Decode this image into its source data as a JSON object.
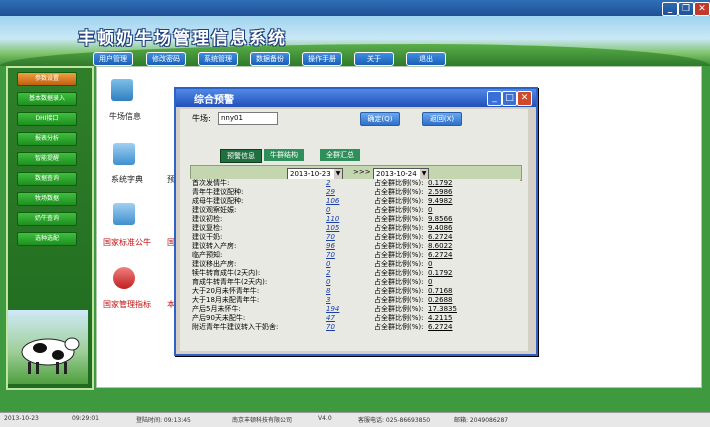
{
  "app": {
    "title": "丰顿奶牛场管理信息系统",
    "nav": [
      "用户管理",
      "修改密码",
      "系统管理",
      "数据备份",
      "操作手册",
      "关于",
      "退出"
    ]
  },
  "sidebar": {
    "items": [
      "参数设置",
      "基本数据录入",
      "DHI接口",
      "报表分析",
      "智能提醒",
      "数据查询",
      "牧场数据",
      "奶牛查询",
      "选种选配"
    ]
  },
  "main": {
    "labels": [
      "牛场信息",
      "系统字典",
      "国家标准公牛",
      "国家管理指标"
    ],
    "partial_labels": [
      "预",
      "国",
      "本"
    ]
  },
  "dialog": {
    "title": "综合预警",
    "cow_label": "牛场:",
    "cow_value": "nny01",
    "confirm_btn": "确定(Q)",
    "back_btn": "返回(X)",
    "tabs": [
      "预警信息",
      "牛群结构",
      "全群汇总"
    ],
    "date_from": "2013-10-23",
    "date_sep": ">>>",
    "date_to": "2013-10-24",
    "rows": [
      {
        "label": "首次发情牛:",
        "count": "2",
        "pct_label": "占全群比例(%):",
        "pct": "0.1792"
      },
      {
        "label": "青年牛建议配种:",
        "count": "29",
        "pct_label": "占全群比例(%):",
        "pct": "2.5986"
      },
      {
        "label": "成母牛建议配种:",
        "count": "106",
        "pct_label": "占全群比例(%):",
        "pct": "9.4982"
      },
      {
        "label": "建议观察妊娠:",
        "count": "0",
        "pct_label": "占全群比例(%):",
        "pct": "0"
      },
      {
        "label": "建议初检:",
        "count": "110",
        "pct_label": "占全群比例(%):",
        "pct": "9.8566"
      },
      {
        "label": "建议复检:",
        "count": "105",
        "pct_label": "占全群比例(%):",
        "pct": "9.4086"
      },
      {
        "label": "建议干奶:",
        "count": "70",
        "pct_label": "占全群比例(%):",
        "pct": "6.2724"
      },
      {
        "label": "建议转入产房:",
        "count": "96",
        "pct_label": "占全群比例(%):",
        "pct": "8.6022"
      },
      {
        "label": "临产预知:",
        "count": "70",
        "pct_label": "占全群比例(%):",
        "pct": "6.2724"
      },
      {
        "label": "建议移出产房:",
        "count": "0",
        "pct_label": "占全群比例(%):",
        "pct": "0"
      },
      {
        "label": "犊牛转育成牛(2天内):",
        "count": "2",
        "pct_label": "占全群比例(%):",
        "pct": "0.1792"
      },
      {
        "label": "育成牛转青年牛(2天内):",
        "count": "0",
        "pct_label": "占全群比例(%):",
        "pct": "0"
      },
      {
        "label": "大于20月未怀青年牛:",
        "count": "8",
        "pct_label": "占全群比例(%):",
        "pct": "0.7168"
      },
      {
        "label": "大于18月未配青年牛:",
        "count": "3",
        "pct_label": "占全群比例(%):",
        "pct": "0.2688"
      },
      {
        "label": "产后5月未怀牛:",
        "count": "194",
        "pct_label": "占全群比例(%):",
        "pct": "17.3835"
      },
      {
        "label": "产后90天未配牛:",
        "count": "47",
        "pct_label": "占全群比例(%):",
        "pct": "4.2115"
      },
      {
        "label": "附近青年牛建议转入干奶舍:",
        "count": "70",
        "pct_label": "占全群比例(%):",
        "pct": "6.2724"
      }
    ]
  },
  "status": {
    "date": "2013-10-23",
    "time": "09:29:01",
    "login_label": "登陆时间: 09:13:45",
    "company": "南京丰顿科技有限公司",
    "version": "V4.0",
    "phone": "客服电话: 025-86693850",
    "email": "邮箱: 2049086287"
  },
  "colors": {
    "title_blue": "#2150b8",
    "panel_green": "#2f7f2a",
    "link_blue": "#1a3ea8"
  }
}
